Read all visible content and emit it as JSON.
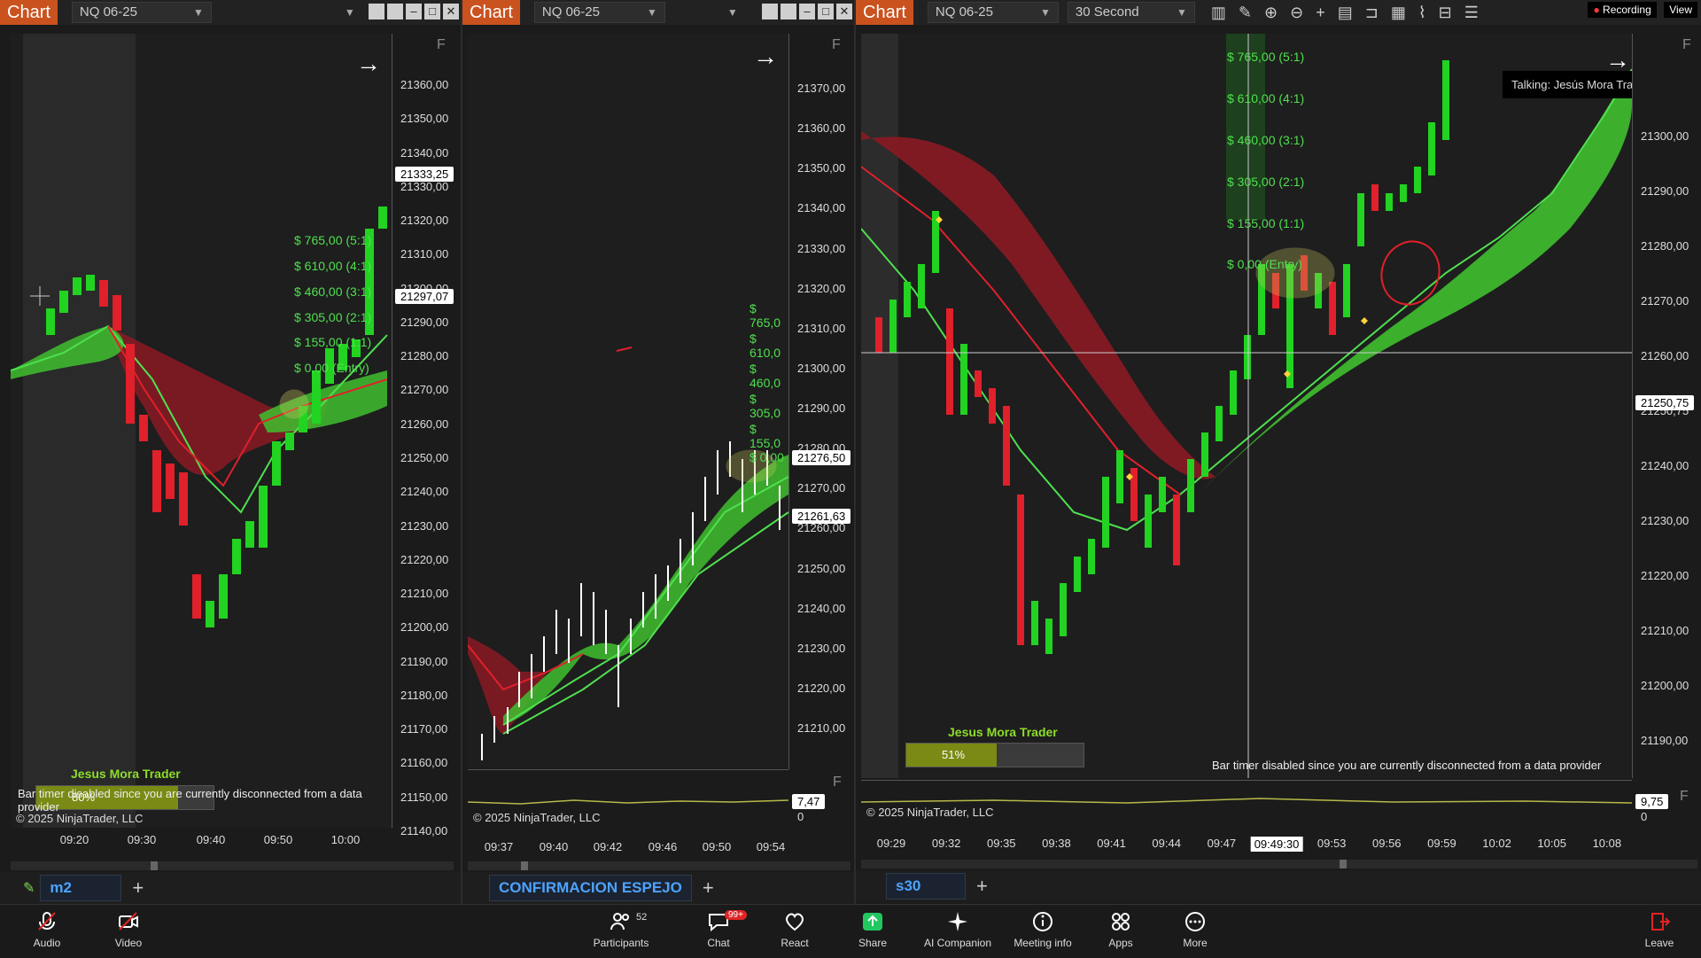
{
  "panels": [
    {
      "tab": "Chart",
      "instrument": "NQ 06-25",
      "price_ticks": [
        "21360,00",
        "21350,00",
        "21340,00",
        "21330,00",
        "21320,00",
        "21310,00",
        "21300,00",
        "21290,00",
        "21280,00",
        "21270,00",
        "21260,00",
        "21250,00",
        "21240,00",
        "21230,00",
        "21220,00",
        "21210,00",
        "21200,00",
        "21190,00",
        "21180,00",
        "21170,00",
        "21160,00",
        "21150,00",
        "21140,00"
      ],
      "time_ticks": [
        "09:20",
        "09:30",
        "09:40",
        "09:50",
        "10:00"
      ],
      "last_price": "21333,25",
      "marker_price": "21297,07",
      "fib_levels": [
        "$ 765,00 (5:1)",
        "$ 610,00 (4:1)",
        "$ 460,00 (3:1)",
        "$ 305,00 (2:1)",
        "$ 155,00 (1:1)",
        "$ 0,00 (Entry)"
      ],
      "brand": "Jesus Mora Trader",
      "progress_pct": "80%",
      "progress_value": 0.8,
      "disconnected": "Bar timer disabled since you are currently disconnected from a data provider",
      "copyright": "© 2025 NinjaTrader, LLC",
      "bottom_tab": "m2",
      "f_label": "F"
    },
    {
      "tab": "Chart",
      "instrument": "NQ 06-25",
      "price_ticks": [
        "21370,00",
        "21360,00",
        "21350,00",
        "21340,00",
        "21330,00",
        "21320,00",
        "21310,00",
        "21300,00",
        "21290,00",
        "21280,00",
        "21270,00",
        "21260,00",
        "21250,00",
        "21240,00",
        "21230,00",
        "21220,00",
        "21210,00"
      ],
      "time_ticks": [
        "09:37",
        "09:40",
        "09:42",
        "09:46",
        "09:50",
        "09:54"
      ],
      "price_tag_1": "21276,50",
      "price_tag_2": "21261,63",
      "fib_levels": [
        "$ 765,0",
        "$ 610,0",
        "$ 460,0",
        "$ 305,0",
        "$ 155,0",
        "$ 0,00"
      ],
      "indicator_value": "7,47",
      "indicator_zero": "0",
      "copyright": "© 2025 NinjaTrader, LLC",
      "bottom_tab": "CONFIRMACION ESPEJO",
      "f_label": "F"
    },
    {
      "tab": "Chart",
      "instrument": "NQ 06-25",
      "timeframe": "30 Second",
      "price_ticks": [
        "21300,00",
        "21290,00",
        "21280,00",
        "21270,00",
        "21260,00",
        "21250,75",
        "21240,00",
        "21230,00",
        "21220,00",
        "21210,00",
        "21200,00",
        "21190,00"
      ],
      "time_ticks": [
        "09:29",
        "09:32",
        "09:35",
        "09:38",
        "09:41",
        "09:44",
        "09:47",
        "09:49:30",
        "09:53",
        "09:56",
        "09:59",
        "10:02",
        "10:05",
        "10:08"
      ],
      "crosshair_price": "21250,75",
      "crosshair_time": "09:49:30",
      "fib_levels": [
        "$ 765,00 (5:1)",
        "$ 610,00 (4:1)",
        "$ 460,00 (3:1)",
        "$ 305,00 (2:1)",
        "$ 155,00 (1:1)",
        "$ 0,00 (Entry)"
      ],
      "brand": "Jesus Mora Trader",
      "progress_pct": "51%",
      "progress_value": 0.51,
      "disconnected": "Bar timer disabled since you are currently disconnected from a data provider",
      "indicator_value": "9,75",
      "indicator_zero": "0",
      "copyright": "© 2025 NinjaTrader, LLC",
      "bottom_tab": "s30",
      "recording": "Recording",
      "view": "View",
      "talking": "Talking: Jesús Mora Trader",
      "f_label": "F"
    }
  ],
  "zoom": {
    "audio": "Audio",
    "video": "Video",
    "participants": "Participants",
    "participants_count": "52",
    "chat": "Chat",
    "chat_badge": "99+",
    "react": "React",
    "share": "Share",
    "ai": "AI Companion",
    "meeting_info": "Meeting info",
    "apps": "Apps",
    "more": "More",
    "leave": "Leave"
  },
  "colors": {
    "accent_orange": "#c9521f",
    "up_candle": "#22d322",
    "down_candle": "#e0202a",
    "cloud_green": "#3fbf2f",
    "cloud_red": "#8a1a24"
  }
}
